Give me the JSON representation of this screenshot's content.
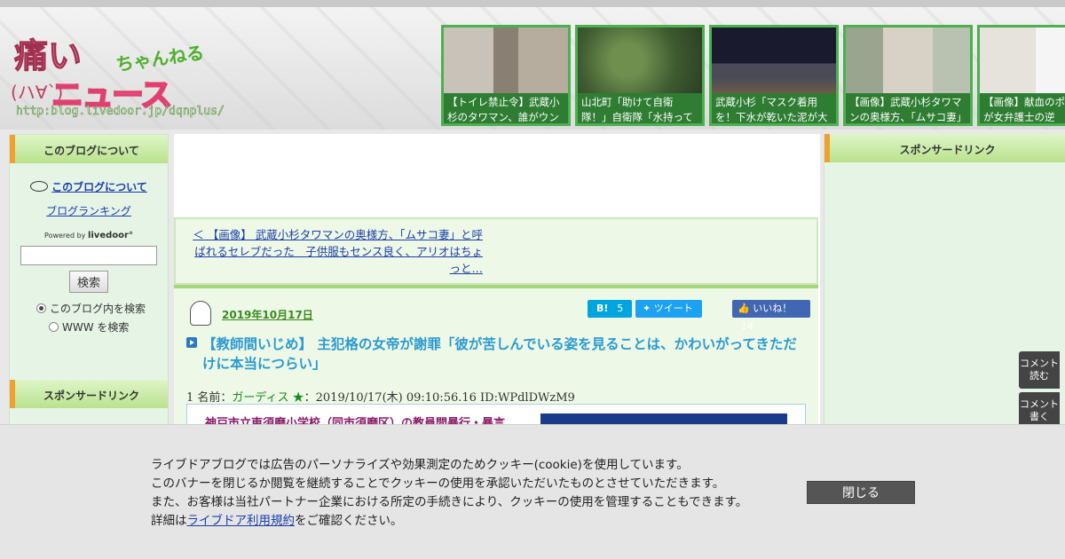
{
  "header": {
    "logo": {
      "kanji": "痛い",
      "chan": "ちゃんねる",
      "face": "(ハ∀`)",
      "news": "ニュース",
      "url": "http:blog.livedoor.jp/dqnplus/"
    },
    "thumbs": [
      {
        "caption": "【トイレ禁止令】武蔵小杉のタワマン、誰がウンコし"
      },
      {
        "caption": "山北町「助けて自衛隊！」自衛隊「水持ってきた"
      },
      {
        "caption": "武蔵小杉「マスク着用を！下水が乾いた泥が大気中を"
      },
      {
        "caption": "【画像】武蔵小杉タワマンの奥様方、「ムサコ妻」と"
      },
      {
        "caption": "【画像】献血のポス何かが女弁護士の逆"
      }
    ]
  },
  "left_sidebar": {
    "heading": "このブログについて",
    "about_link": "このブログについて",
    "ranking_link": "ブログランキング",
    "powered_by": "Powered by",
    "powered_brand": "livedoor°",
    "search_button": "検索",
    "radio_blog": "このブログ内を検索",
    "radio_www": "WWW を検索",
    "sponsor_heading": "スポンサードリンク"
  },
  "main": {
    "prev_link": "＜ 【画像】 武蔵小杉タワマンの奥様方、「ムサコ妻」と呼ばれるセレブだった　子供服もセンス良く、アリオはちょっと…",
    "post_date": "2019年10月17日",
    "hatena_label": "B!",
    "hatena_count": "5",
    "tweet_label": "ツイート",
    "like_label": "いいね！",
    "like_count": "14",
    "post_title": "【教師間いじめ】 主犯格の女帝が謝罪「彼が苦しんでいる姿を見ることは、かわいがってきただけに本当につらい」",
    "res_prefix": "1 名前：",
    "res_name": "ガーディス ★",
    "res_meta": "：2019/10/17(木) 09:10:56.16 ID:WPdlDWzM9",
    "quote_text": "神戸市立東須磨小学校（同市須磨区）の教員間暴行・暴言"
  },
  "right_sidebar": {
    "heading": "スポンサードリンク",
    "comment_read": "コメント読む",
    "comment_write": "コメント書く"
  },
  "cookie_banner": {
    "line1": "ライブドアブログでは広告のパーソナライズや効果測定のためクッキー(cookie)を使用しています。",
    "line2": "このバナーを閉じるか閲覧を継続することでクッキーの使用を承認いただいたものとさせていただきます。",
    "line3": "また、お客様は当社パートナー企業における所定の手続きにより、クッキーの使用を管理することもできます。",
    "line4_prefix": "詳細は",
    "line4_link": "ライブドア利用規約",
    "line4_suffix": "をご確認ください。",
    "close_button": "閉じる"
  },
  "colors": {
    "accent_green": "#4caf50",
    "link_blue": "#1a3ea8",
    "title_blue": "#2a9ad0"
  }
}
